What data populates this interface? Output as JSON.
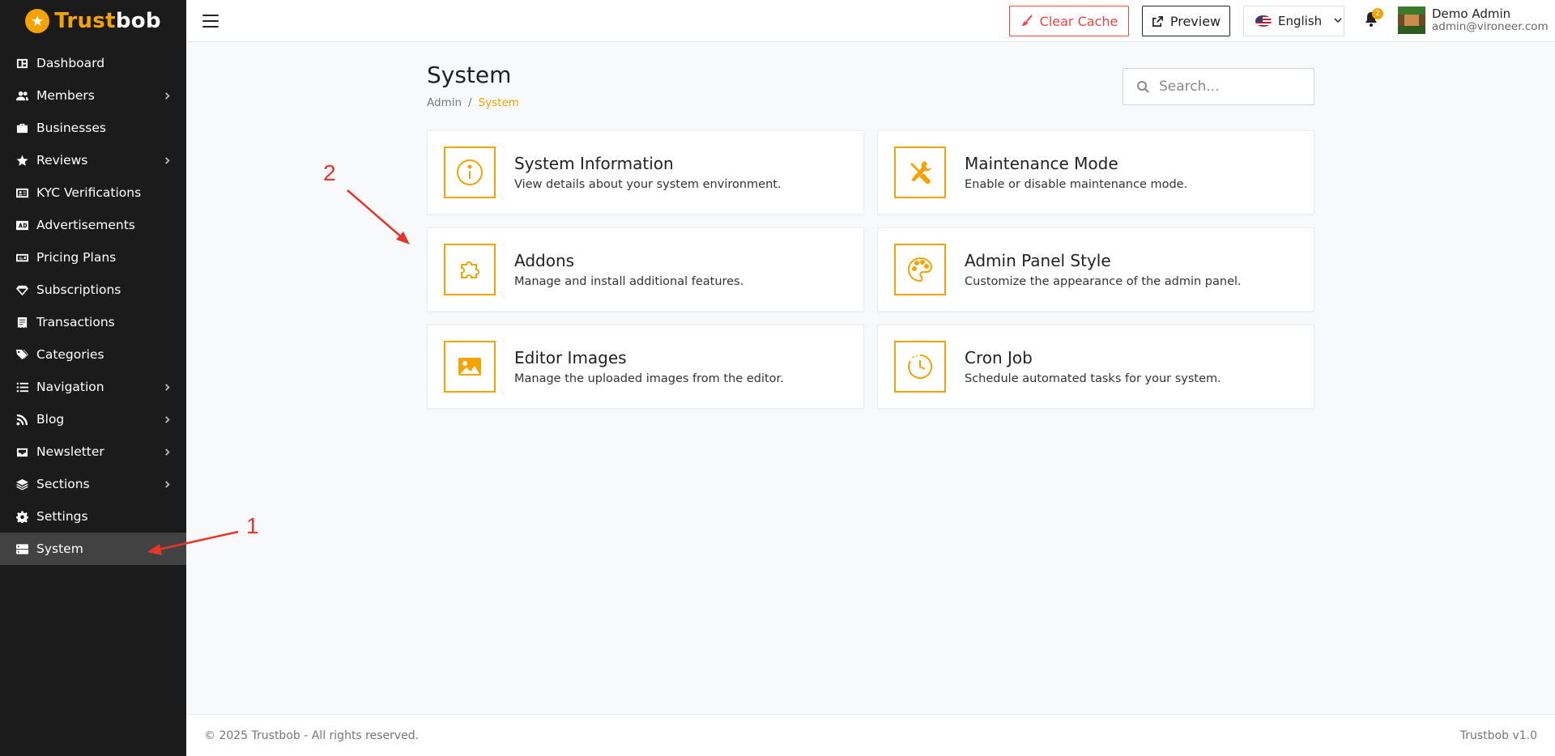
{
  "brand": {
    "part1": "Trust",
    "part2": "bob"
  },
  "sidebar": {
    "items": [
      {
        "label": "Dashboard",
        "icon": "dashboard-icon",
        "has_submenu": false
      },
      {
        "label": "Members",
        "icon": "users-icon",
        "has_submenu": true
      },
      {
        "label": "Businesses",
        "icon": "briefcase-icon",
        "has_submenu": false
      },
      {
        "label": "Reviews",
        "icon": "star-icon",
        "has_submenu": true
      },
      {
        "label": "KYC Verifications",
        "icon": "id-card-icon",
        "has_submenu": false
      },
      {
        "label": "Advertisements",
        "icon": "ad-icon",
        "has_submenu": false
      },
      {
        "label": "Pricing Plans",
        "icon": "money-icon",
        "has_submenu": false
      },
      {
        "label": "Subscriptions",
        "icon": "gem-icon",
        "has_submenu": false
      },
      {
        "label": "Transactions",
        "icon": "receipt-icon",
        "has_submenu": false
      },
      {
        "label": "Categories",
        "icon": "tags-icon",
        "has_submenu": false
      },
      {
        "label": "Navigation",
        "icon": "list-icon",
        "has_submenu": true
      },
      {
        "label": "Blog",
        "icon": "rss-icon",
        "has_submenu": true
      },
      {
        "label": "Newsletter",
        "icon": "inbox-icon",
        "has_submenu": true
      },
      {
        "label": "Sections",
        "icon": "layers-icon",
        "has_submenu": true
      },
      {
        "label": "Settings",
        "icon": "gear-icon",
        "has_submenu": false
      },
      {
        "label": "System",
        "icon": "server-icon",
        "has_submenu": false,
        "active": true
      }
    ]
  },
  "topbar": {
    "clear_cache_label": "Clear Cache",
    "preview_label": "Preview",
    "language": "English",
    "notification_count": "2",
    "user_name": "Demo Admin",
    "user_email": "admin@vironeer.com"
  },
  "page": {
    "title": "System",
    "breadcrumb": [
      "Admin",
      "/",
      "System"
    ],
    "search_placeholder": "Search..."
  },
  "cards": [
    {
      "title": "System Information",
      "description": "View details about your system environment.",
      "icon": "info-icon"
    },
    {
      "title": "Maintenance Mode",
      "description": "Enable or disable maintenance mode.",
      "icon": "tools-icon"
    },
    {
      "title": "Addons",
      "description": "Manage and install additional features.",
      "icon": "puzzle-icon"
    },
    {
      "title": "Admin Panel Style",
      "description": "Customize the appearance of the admin panel.",
      "icon": "palette-icon"
    },
    {
      "title": "Editor Images",
      "description": "Manage the uploaded images from the editor.",
      "icon": "image-icon"
    },
    {
      "title": "Cron Job",
      "description": "Schedule automated tasks for your system.",
      "icon": "clock-icon"
    }
  ],
  "annotations": {
    "first": "1",
    "second": "2"
  },
  "footer": {
    "copyright": "© 2025 Trustbob - All rights reserved.",
    "version": "Trustbob v1.0"
  },
  "colors": {
    "accent": "#f5a300",
    "sidebar_bg": "#1b1b1b",
    "danger": "#ef4444",
    "annotation": "#e8352a"
  }
}
